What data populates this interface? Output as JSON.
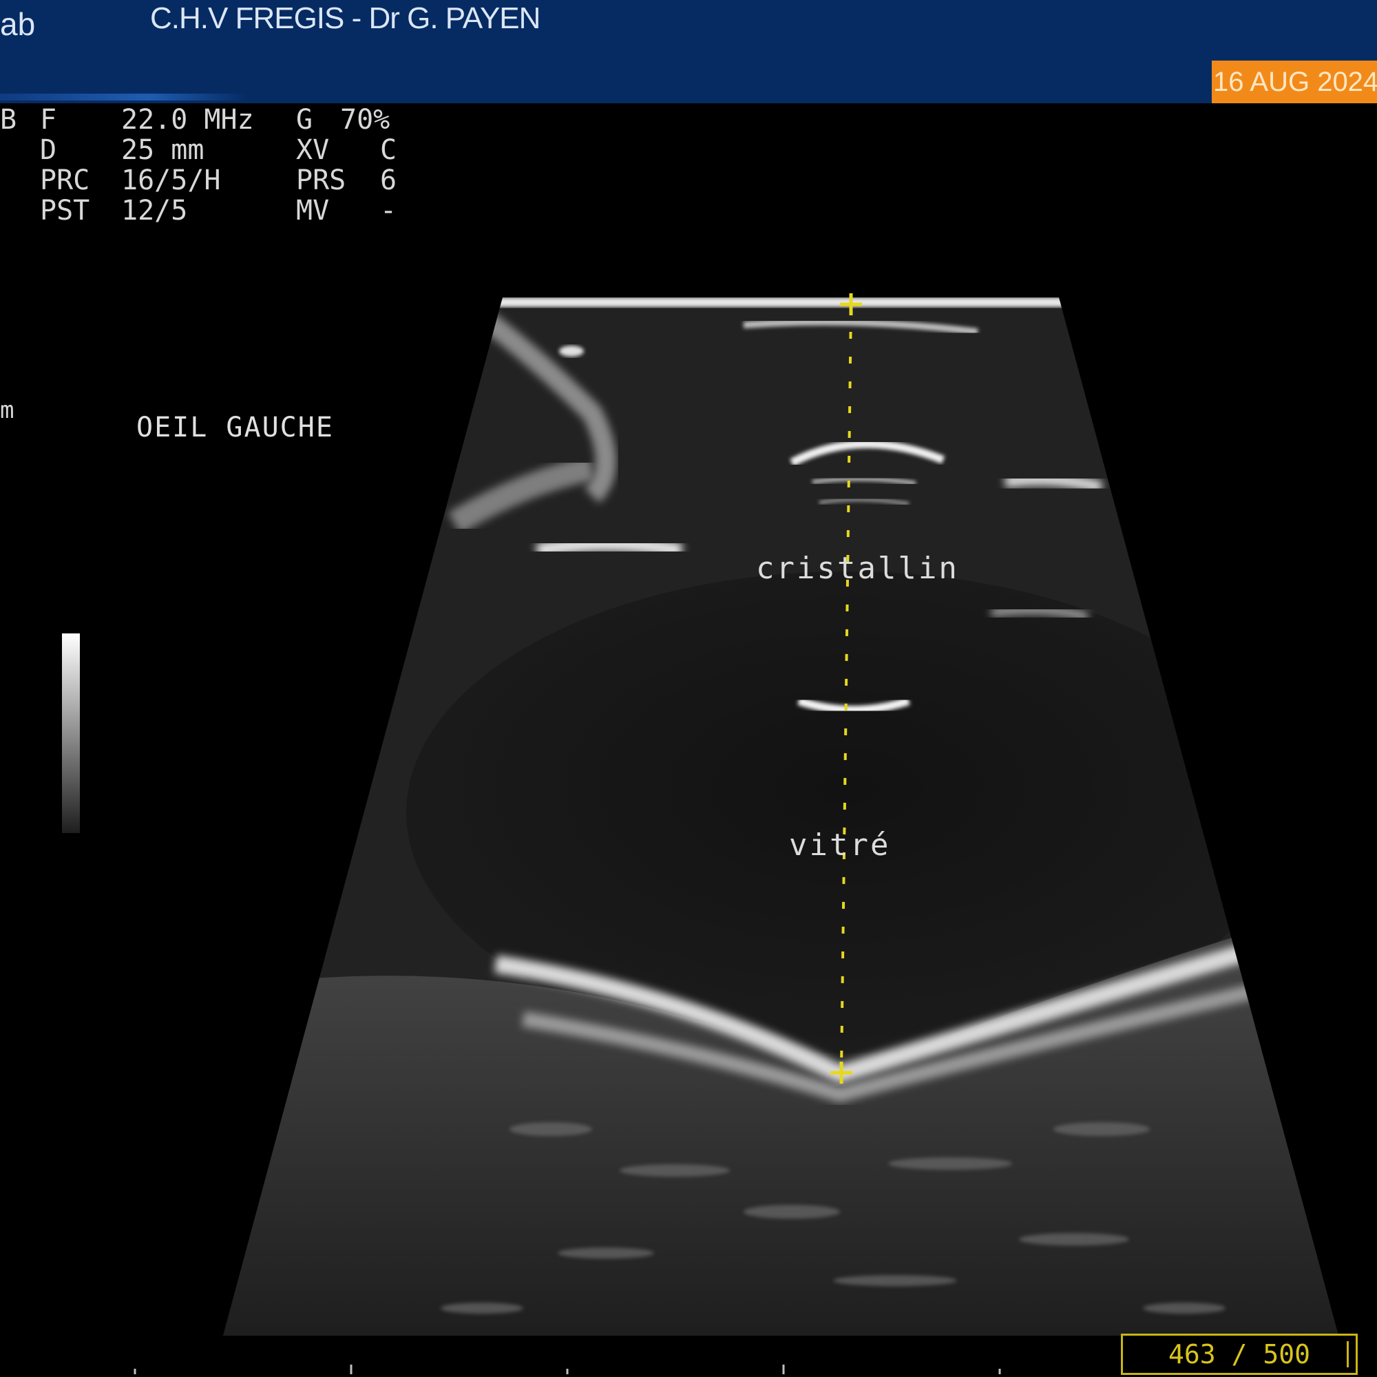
{
  "header": {
    "brand_fragment": "ab",
    "clinic": "C.H.V FREGIS - Dr G. PAYEN",
    "date": "16 AUG 2024"
  },
  "params": {
    "mode": "B",
    "rows": [
      {
        "k1": "F",
        "v1": "22.0 MHz",
        "k2": "G",
        "v2": "70%"
      },
      {
        "k1": "D",
        "v1": "25 mm",
        "k2": "XV",
        "v2": "C"
      },
      {
        "k1": "PRC",
        "v1": "16/5/H",
        "k2": "PRS",
        "v2": "6"
      },
      {
        "k1": "PST",
        "v1": "12/5",
        "k2": "MV",
        "v2": "-"
      }
    ]
  },
  "side_fragment": "m",
  "eye_label": "OEIL GAUCHE",
  "annotations": {
    "lens": "cristallin",
    "vitreous": "vitré"
  },
  "frame_counter": "463 / 500",
  "colors": {
    "header_bg": "#062b63",
    "date_badge": "#f28a1a",
    "caliper": "#e6d81e"
  },
  "icons": [
    "caliper-cross-icon",
    "grayscale-bar"
  ]
}
